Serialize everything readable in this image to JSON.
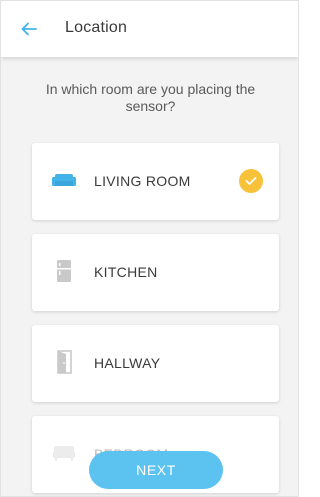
{
  "header": {
    "title": "Location"
  },
  "question": "In which room are you placing the sensor?",
  "rooms": [
    {
      "label": "LIVING ROOM",
      "icon": "sofa-icon",
      "selected": true
    },
    {
      "label": "KITCHEN",
      "icon": "fridge-icon",
      "selected": false
    },
    {
      "label": "HALLWAY",
      "icon": "door-icon",
      "selected": false
    },
    {
      "label": "BEDROOM",
      "icon": "bed-icon",
      "selected": false
    }
  ],
  "next_label": "NEXT",
  "colors": {
    "accent": "#42b4ea",
    "selected_check": "#f7c23a",
    "inactive_icon": "#c9c9c9",
    "button": "#5cc3f0"
  }
}
